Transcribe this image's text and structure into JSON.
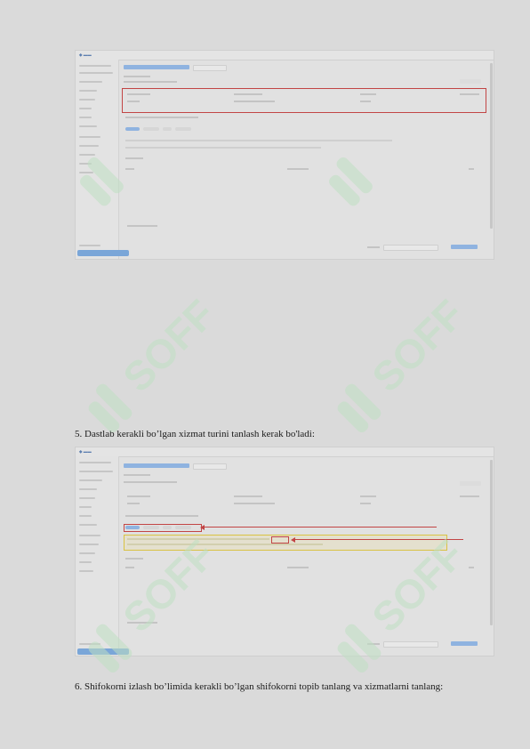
{
  "captions": {
    "step5": "5. Dastlab kerakli bo’lgan xizmat turini tanlash kerak bo'ladi:",
    "step6": "6. Shifokorni izlash bo’limida kerakli bo’lgan shifokorni topib tanlang va xizmatlarni tanlang:"
  },
  "watermark": {
    "text": "SOFF"
  },
  "colors": {
    "highlight_red": "#c24545",
    "highlight_yellow": "#d9c244",
    "accent_blue": "#8fb3e0"
  }
}
